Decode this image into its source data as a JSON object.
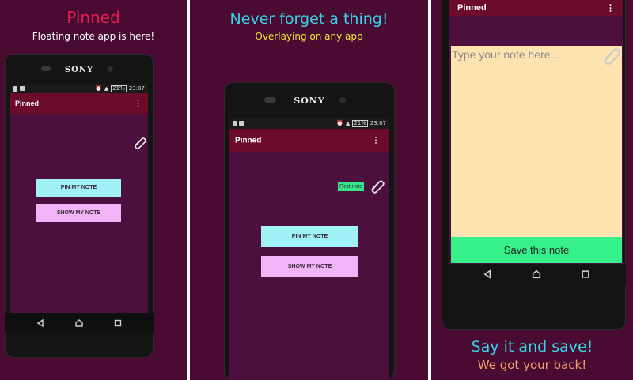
{
  "panels": [
    {
      "headline": "Pinned",
      "subline": "Floating note app is here!",
      "colors": {
        "headline": "#e0214f",
        "subline": "#ffffff"
      },
      "phone": {
        "brand": "SONY",
        "status_time": "23:07",
        "battery": "21%",
        "app_title": "Pinned",
        "menu_icon": "overflow-menu-icon",
        "buttons": {
          "pin": "PIN MY NOTE",
          "show": "SHOW MY NOTE"
        },
        "clip_icon": "paperclip-icon"
      }
    },
    {
      "headline": "Never forget a thing!",
      "subline": "Overlaying on any app",
      "colors": {
        "headline": "#35d6e6",
        "subline": "#f6e23a"
      },
      "phone": {
        "brand": "SONY",
        "status_time": "23:07",
        "battery": "21%",
        "app_title": "Pinned",
        "menu_icon": "overflow-menu-icon",
        "floating_note": "First note",
        "buttons": {
          "pin": "PIN MY NOTE",
          "show": "SHOW MY NOTE"
        },
        "clip_icon": "paperclip-icon"
      }
    },
    {
      "headline": "Say it and save!",
      "subline": "We got your back!",
      "colors": {
        "headline": "#35d6e6",
        "subline": "#f4a36a"
      },
      "phone": {
        "app_title": "Pinned",
        "menu_icon": "overflow-menu-icon",
        "note_placeholder": "Type your note here...",
        "save_label": "Save this note",
        "clip_icon": "paperclip-icon"
      }
    }
  ],
  "nav_icons": [
    "back-icon",
    "home-icon",
    "recents-icon"
  ]
}
